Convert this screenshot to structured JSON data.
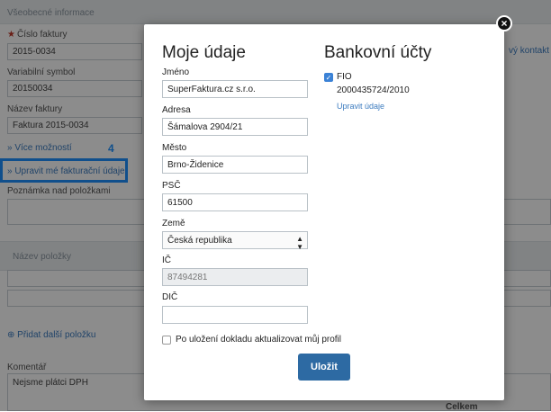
{
  "background": {
    "section_title": "Všeobecné informace",
    "invoice_number_label": "Číslo faktury",
    "invoice_number_value": "2015-0034",
    "variable_symbol_label": "Variabilní symbol",
    "variable_symbol_value": "20150034",
    "invoice_name_label": "Název faktury",
    "invoice_name_value": "Faktura 2015-0034",
    "more_options_link": "» Více možností",
    "edit_billing_link": "» Upravit mé fakturační údaje",
    "step_number": "4",
    "note_label": "Poznámka nad položkami",
    "item_name_header": "Název položky",
    "add_item_link": "Přidat další položku",
    "comment_label": "Komentář",
    "comment_value": "Nejsme plátci DPH",
    "total_label": "Celkem",
    "new_contact_partial": "vý kontakt"
  },
  "modal": {
    "title": "Moje údaje",
    "fields": {
      "name_label": "Jméno",
      "name_value": "SuperFaktura.cz s.r.o.",
      "address_label": "Adresa",
      "address_value": "Šámalova 2904/21",
      "city_label": "Město",
      "city_value": "Brno-Židenice",
      "zip_label": "PSČ",
      "zip_value": "61500",
      "country_label": "Země",
      "country_value": "Česká republika",
      "ico_label": "IČ",
      "ico_value": "87494281",
      "dic_label": "DIČ",
      "dic_value": ""
    },
    "bank": {
      "title": "Bankovní účty",
      "account_name": "FIO",
      "account_number": "2000435724/2010",
      "edit_link": "Upravit údaje"
    },
    "update_profile_label": "Po uložení dokladu aktualizovat můj profil",
    "save_label": "Uložit",
    "close_symbol": "×"
  }
}
